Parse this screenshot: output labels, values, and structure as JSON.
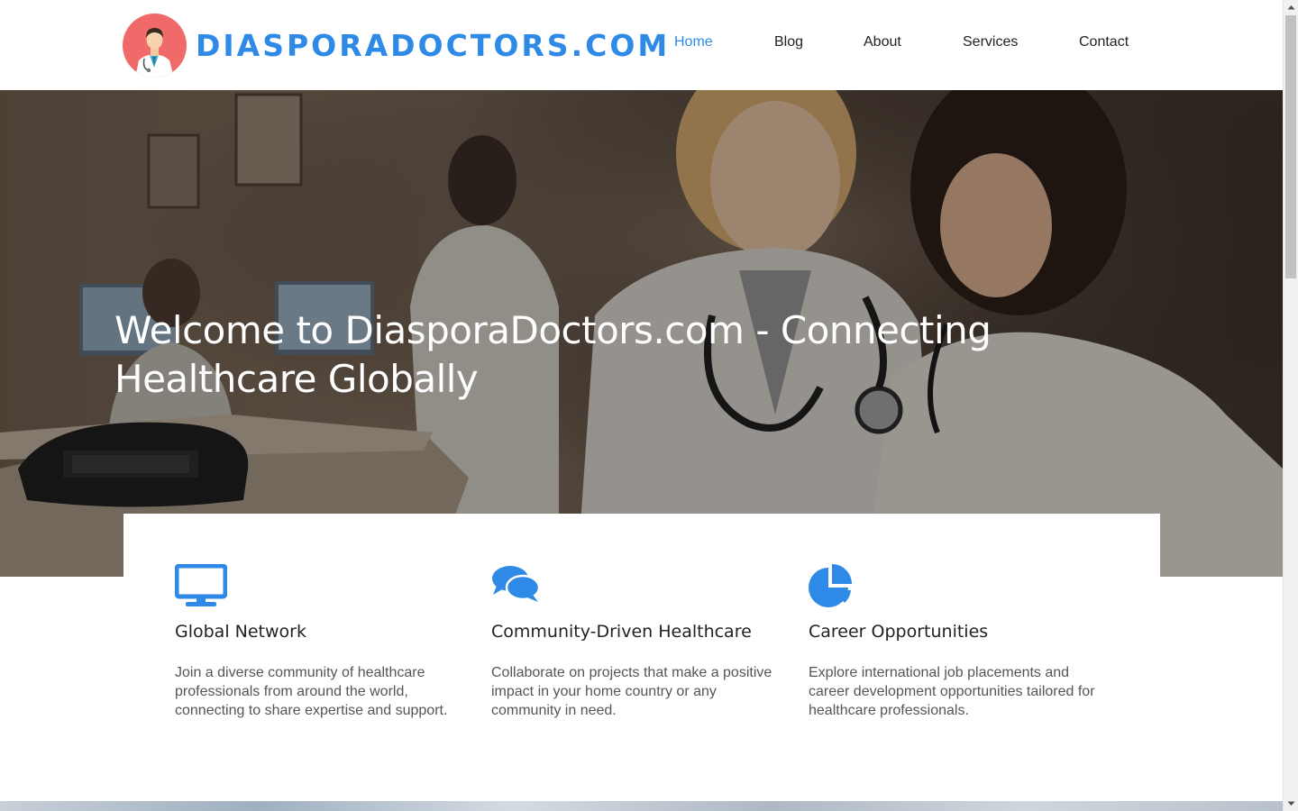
{
  "brand": {
    "name": "DIASPORADOCTORS.COM",
    "logo_icon": "doctor-avatar-icon",
    "logo_color": "#f06a6a",
    "brand_color": "#2e8ae6"
  },
  "nav": {
    "items": [
      {
        "label": "Home",
        "active": true
      },
      {
        "label": "Blog",
        "active": false
      },
      {
        "label": "About",
        "active": false
      },
      {
        "label": "Services",
        "active": false
      },
      {
        "label": "Contact",
        "active": false
      }
    ]
  },
  "hero": {
    "title": "Welcome to DiasporaDoctors.com - Connecting Healthcare Globally"
  },
  "features": [
    {
      "icon": "monitor-icon",
      "title": "Global Network",
      "text": "Join a diverse community of healthcare professionals from around the world, connecting to share expertise and support."
    },
    {
      "icon": "chat-bubbles-icon",
      "title": "Community-Driven Healthcare",
      "text": "Collaborate on projects that make a positive impact in your home country or any community in need."
    },
    {
      "icon": "pie-chart-icon",
      "title": "Career Opportunities",
      "text": "Explore international job placements and career development opportunities tailored for healthcare professionals."
    }
  ],
  "colors": {
    "accent": "#2e8ae6",
    "text": "#222222",
    "muted_text": "#555555"
  }
}
